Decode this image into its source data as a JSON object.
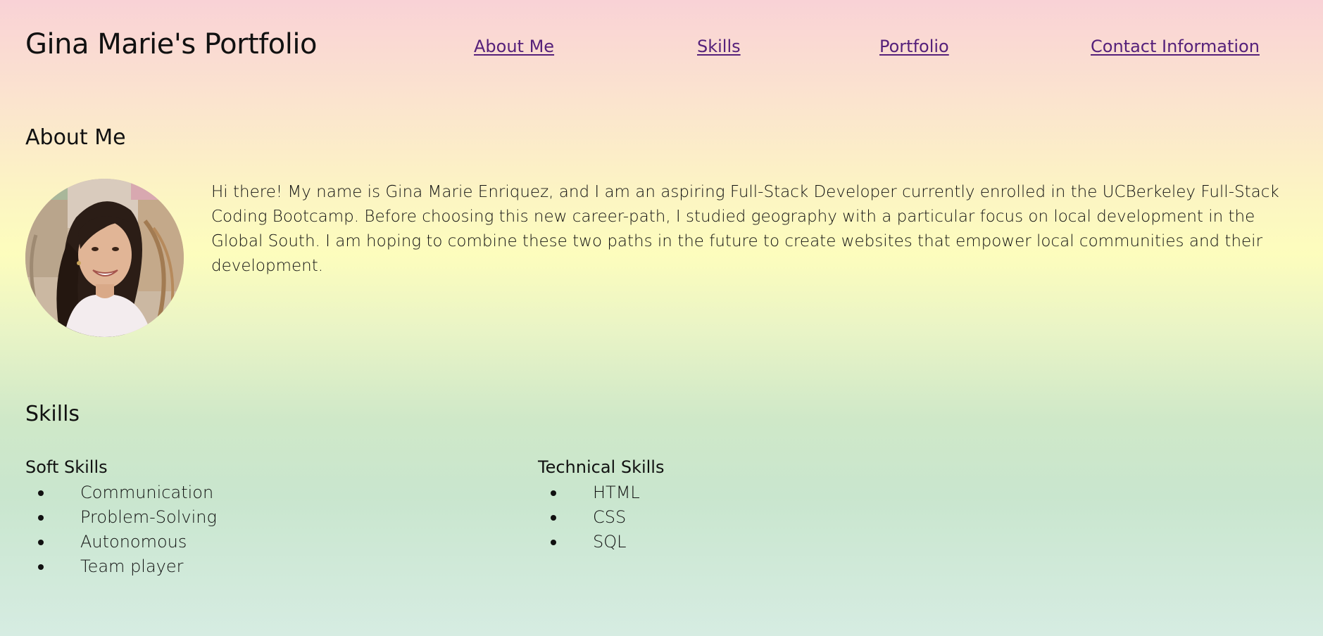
{
  "header": {
    "site_title": "Gina Marie's Portfolio",
    "nav": [
      {
        "label": "About Me"
      },
      {
        "label": "Skills"
      },
      {
        "label": "Portfolio"
      },
      {
        "label": "Contact Information"
      }
    ]
  },
  "about": {
    "heading": "About Me",
    "avatar_alt": "Photo of Gina Marie",
    "bio": "Hi there! My name is Gina Marie Enriquez, and I am an aspiring Full-Stack Developer currently enrolled in the UCBerkeley Full-Stack Coding Bootcamp. Before choosing this new career-path, I studied geography with a particular focus on local development in the Global South. I am hoping to combine these two paths in the future to create websites that empower local communities and their development."
  },
  "skills": {
    "heading": "Skills",
    "soft": {
      "title": "Soft Skills",
      "items": [
        "Communication",
        "Problem-Solving",
        "Autonomous",
        "Team player"
      ]
    },
    "technical": {
      "title": "Technical Skills",
      "items": [
        "HTML",
        "CSS",
        "SQL"
      ]
    }
  },
  "colors": {
    "link": "#55207a",
    "background_top": "#f9d2d6",
    "background_middle": "#fdfdbd",
    "background_bottom": "#d6ece2"
  }
}
